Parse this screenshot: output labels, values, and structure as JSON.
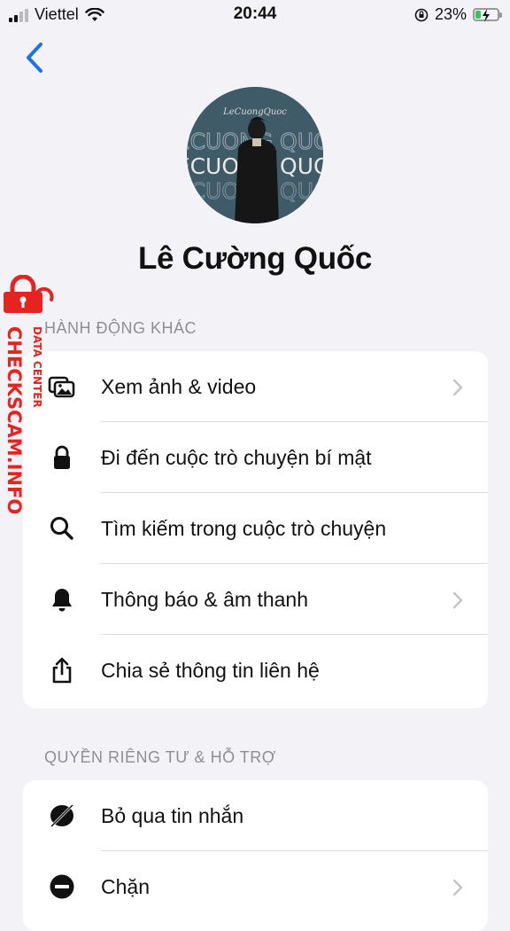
{
  "status_bar": {
    "carrier": "Viettel",
    "time": "20:44",
    "battery_percent": "23%",
    "battery_level": 0.23
  },
  "profile": {
    "name": "Lê Cường Quốc",
    "avatar_signature": "LeCuongQuoc",
    "avatar_text": "LECUONG QUOC"
  },
  "sections": {
    "actions": {
      "header": "HÀNH ĐỘNG KHÁC",
      "items": [
        {
          "label": "Xem ảnh & video",
          "icon": "photos-icon",
          "chevron": true
        },
        {
          "label": "Đi đến cuộc trò chuyện bí mật",
          "icon": "lock-icon",
          "chevron": false
        },
        {
          "label": "Tìm kiếm trong cuộc trò chuyện",
          "icon": "search-icon",
          "chevron": false
        },
        {
          "label": "Thông báo & âm thanh",
          "icon": "bell-icon",
          "chevron": true
        },
        {
          "label": "Chia sẻ thông tin liên hệ",
          "icon": "share-icon",
          "chevron": false
        }
      ]
    },
    "privacy": {
      "header": "QUYỀN RIÊNG TƯ & HỖ TRỢ",
      "items": [
        {
          "label": "Bỏ qua tin nhắn",
          "icon": "ignore-icon",
          "chevron": false
        },
        {
          "label": "Chặn",
          "icon": "block-icon",
          "chevron": true
        }
      ]
    }
  },
  "watermark": {
    "line1": "CHECKSCAM.INFO",
    "line2": "DATA CENTER"
  },
  "colors": {
    "accent": "#1a73e8",
    "background": "#f2f2f7",
    "watermark_red": "#e52421"
  }
}
